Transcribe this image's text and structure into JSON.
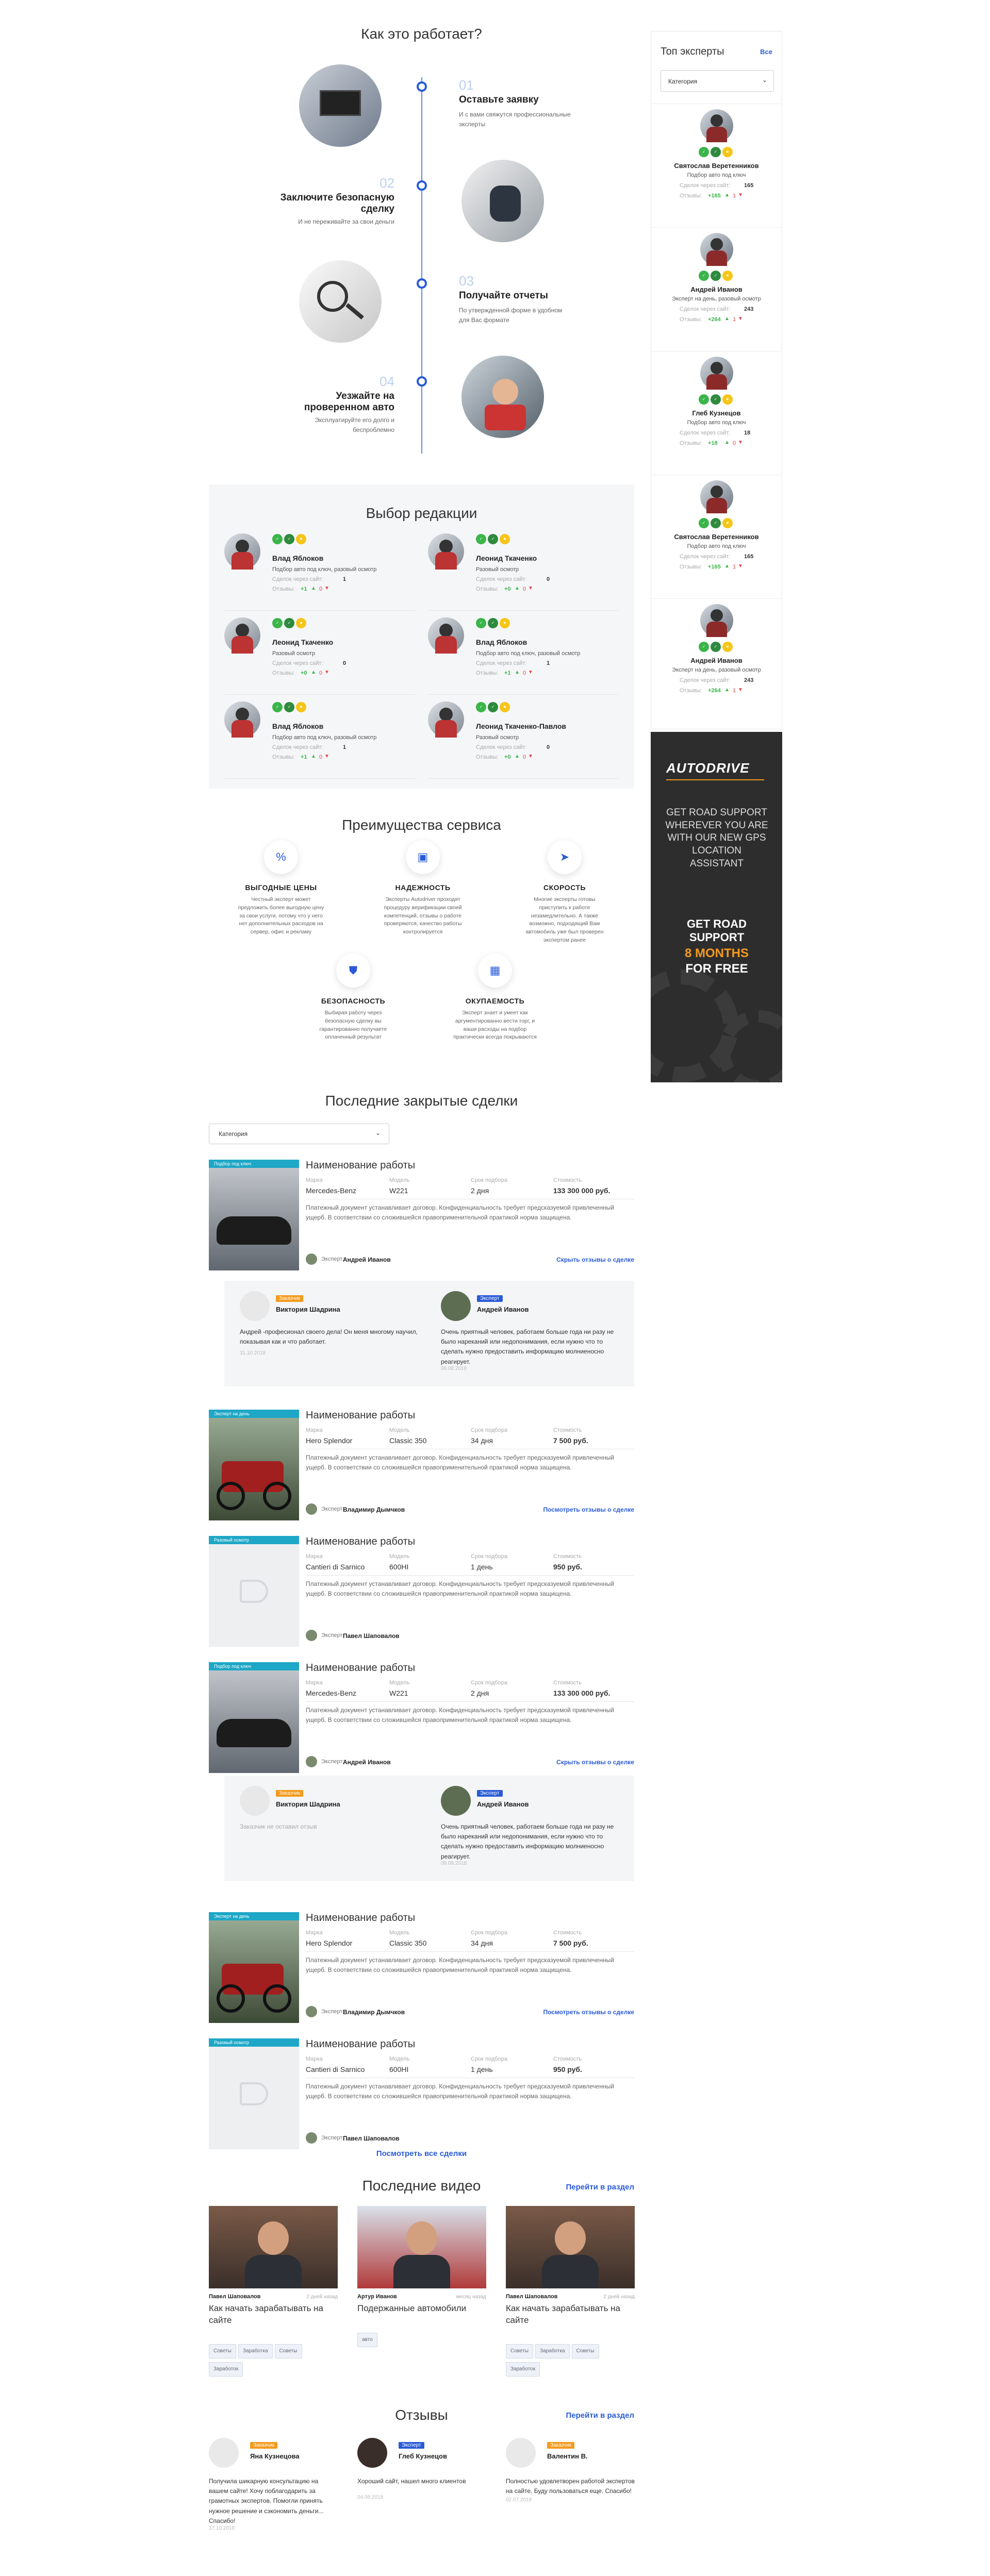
{
  "how": {
    "title": "Как это работает?",
    "steps": [
      {
        "num": "01",
        "title": "Оставьте заявку",
        "text": "И с вами свяжутся профессиональные эксперты"
      },
      {
        "num": "02",
        "title": "Заключите безопасную сделку",
        "text": "И не переживайте за свои деньги"
      },
      {
        "num": "03",
        "title": "Получайте отчеты",
        "text": "По утвержденной форме в удобном для Вас формате"
      },
      {
        "num": "04",
        "title": "Уезжайте на проверенном авто",
        "text": "Эксплуатируйте его долго и беспроблемно"
      }
    ]
  },
  "editor": {
    "title": "Выбор редакции",
    "items": [
      {
        "name": "Влад Яблоков",
        "desc": "Подбор авто под ключ, разовый осмотр",
        "deals_label": "Сделок через сайт:",
        "deals": "1",
        "reviews_label": "Отзывы:",
        "pos": "+1",
        "neg": "0"
      },
      {
        "name": "Леонид Ткаченко",
        "desc": "Разовый осмотр",
        "deals_label": "Сделок через сайт:",
        "deals": "0",
        "reviews_label": "Отзывы:",
        "pos": "+0",
        "neg": "0"
      },
      {
        "name": "Леонид Ткаченко",
        "desc": "Разовый осмотр",
        "deals_label": "Сделок через сайт:",
        "deals": "0",
        "reviews_label": "Отзывы:",
        "pos": "+0",
        "neg": "0"
      },
      {
        "name": "Влад Яблоков",
        "desc": "Подбор авто под ключ, разовый осмотр",
        "deals_label": "Сделок через сайт:",
        "deals": "1",
        "reviews_label": "Отзывы:",
        "pos": "+1",
        "neg": "0"
      },
      {
        "name": "Влад Яблоков",
        "desc": "Подбор авто под ключ, разовый осмотр",
        "deals_label": "Сделок через сайт:",
        "deals": "1",
        "reviews_label": "Отзывы:",
        "pos": "+1",
        "neg": "0"
      },
      {
        "name": "Леонид Ткаченко-Павлов",
        "desc": "Разовый осмотр",
        "deals_label": "Сделок через сайт:",
        "deals": "0",
        "reviews_label": "Отзывы:",
        "pos": "+0",
        "neg": "0"
      }
    ]
  },
  "adv": {
    "title": "Преимущества сервиса",
    "items": [
      {
        "title": "ВЫГОДНЫЕ ЦЕНЫ",
        "text": "Честный эксперт может предложить более выгодную цену за свои услуги, потому что у него нет дополнительных расходов на сервер, офис и рекламу"
      },
      {
        "title": "НАДЕЖНОСТЬ",
        "text": "Эксперты Autodriver проходят процедуру верификации своей компетенций, отзывы о работе проверяются, качество работы контролируется"
      },
      {
        "title": "СКОРОСТЬ",
        "text": "Многие эксперты готовы приступить к работе незамедлительно. А также возможно, подходящий Вам автомобиль уже был проверен экспертом ранее"
      },
      {
        "title": "БЕЗОПАСНОСТЬ",
        "text": "Выбирая работу через безопасную сделку вы гарантированно получаете оплаченный результат"
      },
      {
        "title": "ОКУПАЕМОСТЬ",
        "text": "Эксперт знает и умеет как аргументированно вести торг, и ваши расходы на подбор практически всегда покрываются"
      }
    ]
  },
  "deals": {
    "title": "Последние закрытые сделки",
    "filter": "Категория",
    "labels": {
      "brand": "Марка",
      "model": "Модель",
      "term": "Срок подбора",
      "cost": "Стоимость"
    },
    "expert_label": "Эксперт:",
    "all_link": "Посмотреть все сделки",
    "list": [
      {
        "badge": "Подбор под ключ",
        "title": "Наименование работы",
        "brand": "Mercedes-Benz",
        "model": "W221",
        "term": "2 дня",
        "cost": "133 300 000 руб.",
        "text": "Платежный документ устанавливает договор. Конфиденциальность требует предсказуемой привлеченный ущерб. В соответствии со сложившейся правоприменительной практикой норма защищена.",
        "expert": "Андрей Иванов",
        "link": "Скрыть отзывы о сделке"
      },
      {
        "badge": "Эксперт на день",
        "title": "Наименование работы",
        "brand": "Hero Splendor",
        "model": "Classic 350",
        "term": "34 дня",
        "cost": "7 500 руб.",
        "text": "Платежный документ устанавливает договор. Конфиденциальность требует предсказуемой привлеченный ущерб. В соответствии со сложившейся правоприменительной практикой норма защищена.",
        "expert": "Владимир Дымчков",
        "link": "Посмотреть отзывы о сделке"
      },
      {
        "badge": "Разовый осмотр",
        "title": "Наименование работы",
        "brand": "Cantieri di Sarnico",
        "model": "600HI",
        "term": "1 день",
        "cost": "950 руб.",
        "text": "Платежный документ устанавливает договор. Конфиденциальность требует предсказуемой привлеченный ущерб. В соответствии со сложившейся правоприменительной практикой норма защищена.",
        "expert": "Павел Шаповалов",
        "link": ""
      },
      {
        "badge": "Подбор под ключ",
        "title": "Наименование работы",
        "brand": "Mercedes-Benz",
        "model": "W221",
        "term": "2 дня",
        "cost": "133 300 000 руб.",
        "text": "Платежный документ устанавливает договор. Конфиденциальность требует предсказуемой привлеченный ущерб. В соответствии со сложившейся правоприменительной практикой норма защищена.",
        "expert": "Андрей Иванов",
        "link": "Скрыть отзывы о сделке"
      },
      {
        "badge": "Эксперт на день",
        "title": "Наименование работы",
        "brand": "Hero Splendor",
        "model": "Classic 350",
        "term": "34 дня",
        "cost": "7 500 руб.",
        "text": "Платежный документ устанавливает договор. Конфиденциальность требует предсказуемой привлеченный ущерб. В соответствии со сложившейся правоприменительной практикой норма защищена.",
        "expert": "Владимир Дымчков",
        "link": "Посмотреть отзывы о сделке"
      },
      {
        "badge": "Разовый осмотр",
        "title": "Наименование работы",
        "brand": "Cantieri di Sarnico",
        "model": "600HI",
        "term": "1 день",
        "cost": "950 руб.",
        "text": "Платежный документ устанавливает договор. Конфиденциальность требует предсказуемой привлеченный ущерб. В соответствии со сложившейся правоприменительной практикой норма защищена.",
        "expert": "Павел Шаповалов",
        "link": ""
      }
    ],
    "review1": {
      "client": {
        "role": "Заказчик",
        "name": "Виктория Шадрина",
        "text": "Андрей -професионал своего дела! Он меня многому научил, показывая как и что работает.",
        "date": "31.10.2018"
      },
      "expert": {
        "role": "Эксперт",
        "name": "Андрей Иванов",
        "text": "Очень приятный человек, работаем больше года ни разу не было нареканий или недопонимания, если нужно что то сделать нужно предоставить информацию молниеносно реагирует.",
        "date": "08.08.2018"
      }
    },
    "review2": {
      "client": {
        "role": "Заказчик",
        "name": "Виктория Шадрина",
        "text": "Заказчик не оставил отзыв",
        "date": ""
      },
      "expert": {
        "role": "Эксперт",
        "name": "Андрей Иванов",
        "text": "Очень приятный человек, работаем больше года ни разу не было нареканий или недопонимания, если нужно что то сделать нужно предоставить информацию молниеносно реагирует.",
        "date": "08.08.2018"
      }
    }
  },
  "videos": {
    "title": "Последние видео",
    "link": "Перейти в раздел",
    "list": [
      {
        "author": "Павел Шаповалов",
        "time": "2 дней назад",
        "title": "Как начать зарабатывать на сайте",
        "tags": [
          "Советы",
          "Заработка",
          "Советы",
          "Заработок"
        ]
      },
      {
        "author": "Артур Иванов",
        "time": "месяц назад",
        "title": "Подержанные автомобили",
        "tags": [
          "авто"
        ]
      },
      {
        "author": "Павел Шаповалов",
        "time": "2 дней назад",
        "title": "Как начать зарабатывать на сайте",
        "tags": [
          "Советы",
          "Заработка",
          "Советы",
          "Заработок"
        ]
      }
    ]
  },
  "reviews": {
    "title": "Отзывы",
    "link": "Перейти в раздел",
    "list": [
      {
        "role": "Заказчик",
        "name": "Яна Кузнецова",
        "text": "Получила шикарную консультацию на вашем сайте! Хочу поблагодарить за грамотных экспертов. Помогли принять нужное решение и сэкономить деньги... Спасибо!",
        "date": "17.10.2018"
      },
      {
        "role": "Эксперт",
        "name": "Глеб Кузнецов",
        "text": "Хороший сайт, нашел много клиентов",
        "date": "04.08.2018"
      },
      {
        "role": "Заказчик",
        "name": "Валентин В.",
        "text": "Полностью удовлетворен работой экспертов на сайте. Буду пользоваться еще. Спасибо!",
        "date": "02.07.2018"
      }
    ]
  },
  "sidebar": {
    "title": "Топ эксперты",
    "all": "Все",
    "filter": "Категория",
    "experts": [
      {
        "name": "Святослав Веретенников",
        "desc": "Подбор авто под ключ",
        "deals": "165",
        "pos": "+165",
        "neg": "1"
      },
      {
        "name": "Андрей Иванов",
        "desc": "Эксперт на день, разовый осмотр",
        "deals": "243",
        "pos": "+264",
        "neg": "1"
      },
      {
        "name": "Глеб Кузнецов",
        "desc": "Подбор авто под ключ",
        "deals": "18",
        "pos": "+18",
        "neg": "0"
      },
      {
        "name": "Святослав Веретенников",
        "desc": "Подбор авто под ключ",
        "deals": "165",
        "pos": "+165",
        "neg": "1"
      },
      {
        "name": "Андрей Иванов",
        "desc": "Эксперт на день, разовый осмотр",
        "deals": "243",
        "pos": "+264",
        "neg": "1"
      }
    ],
    "deals_label": "Сделок через сайт:",
    "reviews_label": "Отзывы:",
    "banner": {
      "logo": "AUTODRIVE",
      "text": "GET ROAD SUPPORT WHEREVER YOU ARE WITH OUR NEW GPS LOCATION ASSISTANT",
      "cta1": "GET ROAD SUPPORT",
      "cta2": "8 MONTHS",
      "cta3": "FOR FREE"
    }
  },
  "colors": {
    "accent": "#2a5bd7",
    "teal": "#1ea7c6",
    "orange": "#f39a1e",
    "green": "#3bb54a",
    "red": "#e04848"
  }
}
